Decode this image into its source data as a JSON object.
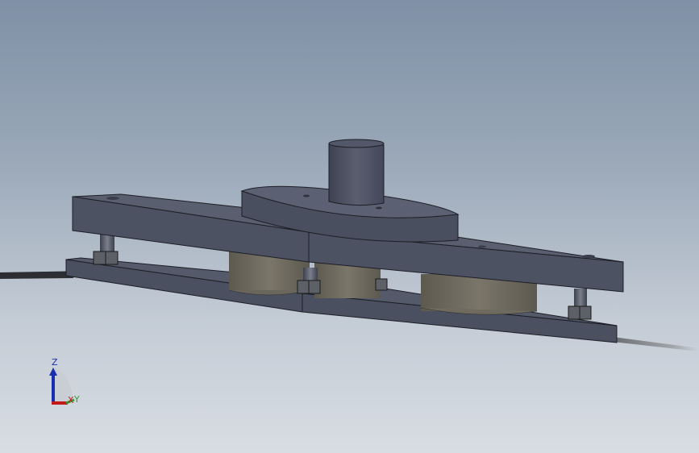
{
  "viewport": {
    "background_top": "#7f90a6",
    "background_bottom": "#d8dde3",
    "model_color": "#4d5263",
    "spring_color": "#757062"
  },
  "triad": {
    "z_label": "Z",
    "x_label": "X",
    "y_label": "Y",
    "z_color": "#1a2fb0",
    "x_color": "#c41a1a",
    "y_color": "#2fa02f"
  }
}
